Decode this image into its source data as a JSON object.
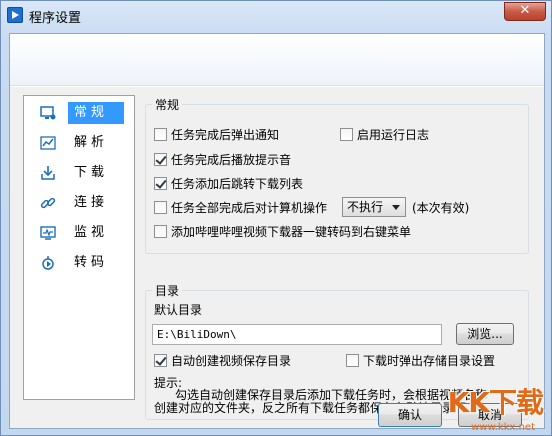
{
  "window": {
    "title": "程序设置",
    "close_label": "✕"
  },
  "sidebar": {
    "items": [
      {
        "label": "常规",
        "icon": "monitor-settings-icon",
        "selected": true
      },
      {
        "label": "解析",
        "icon": "chart-icon",
        "selected": false
      },
      {
        "label": "下载",
        "icon": "download-icon",
        "selected": false
      },
      {
        "label": "连接",
        "icon": "link-icon",
        "selected": false
      },
      {
        "label": "监视",
        "icon": "monitor-icon",
        "selected": false
      },
      {
        "label": "转码",
        "icon": "transcode-icon",
        "selected": false
      }
    ]
  },
  "general": {
    "title": "常规",
    "opt_notify": {
      "label": "任务完成后弹出通知",
      "checked": false
    },
    "opt_log": {
      "label": "启用运行日志",
      "checked": false
    },
    "opt_sound": {
      "label": "任务完成后播放提示音",
      "checked": true
    },
    "opt_jump": {
      "label": "任务添加后跳转下载列表",
      "checked": true
    },
    "opt_action": {
      "label": "任务全部完成后对计算机操作",
      "checked": false
    },
    "action_select": "不执行",
    "action_note": "(本次有效)",
    "opt_menu": {
      "label": "添加哔哩哔哩视频下载器一键转码到右键菜单",
      "checked": false
    }
  },
  "directory": {
    "title": "目录",
    "default_label": "默认目录",
    "path": "E:\\BiliDown\\",
    "browse_label": "浏览...",
    "opt_autocreate": {
      "label": "自动创建视频保存目录",
      "checked": true
    },
    "opt_popup": {
      "label": "下载时弹出存储目录设置",
      "checked": false
    },
    "hint_title": "提示:",
    "hint_line1": "勾选自动创建保存目录后添加下载任务时，会根据视频名称",
    "hint_line2": "创建对应的文件夹，反之所有下载任务都保存在默认目录下。"
  },
  "buttons": {
    "ok": "确认",
    "cancel": "取消"
  },
  "watermark": {
    "logo": "KK下载",
    "url": "www.kkx.net"
  }
}
